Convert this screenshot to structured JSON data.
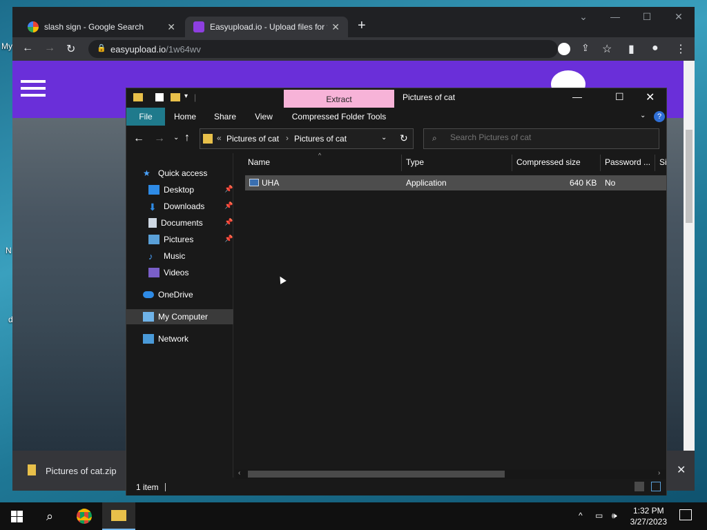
{
  "desktop": {
    "left_fragments": [
      "My",
      "N",
      "d"
    ]
  },
  "browser": {
    "tabs": [
      {
        "title": "slash sign - Google Search"
      },
      {
        "title": "Easyupload.io - Upload files for f"
      }
    ],
    "new_tab": "+",
    "url_host": "easyupload.io",
    "url_path": "/1w64wv",
    "download": {
      "filename": "Pictures of cat.zip"
    }
  },
  "explorer": {
    "qat_sep": "|",
    "contextual_tab": "Extract",
    "title": "Pictures of cat",
    "ribbon_tabs": [
      "File",
      "Home",
      "Share",
      "View",
      "Compressed Folder Tools"
    ],
    "breadcrumb": [
      "Pictures of cat",
      "Pictures of cat"
    ],
    "breadcrumb_prefix": "«",
    "breadcrumb_sep": "›",
    "search_placeholder": "Search Pictures of cat",
    "nav": {
      "quick_access": "Quick access",
      "items": [
        "Desktop",
        "Downloads",
        "Documents",
        "Pictures",
        "Music",
        "Videos"
      ],
      "onedrive": "OneDrive",
      "my_computer": "My Computer",
      "network": "Network"
    },
    "columns": [
      "Name",
      "Type",
      "Compressed size",
      "Password ...",
      "Si"
    ],
    "files": [
      {
        "name": "UHA",
        "type": "Application",
        "size": "640 KB",
        "password": "No"
      }
    ],
    "status": "1 item"
  },
  "taskbar": {
    "time": "1:32 PM",
    "date": "3/27/2023"
  },
  "colors": {
    "accent": "#6a2fd9",
    "extract_tab": "#f7b3d8",
    "file_tab": "#1f7a8c"
  }
}
